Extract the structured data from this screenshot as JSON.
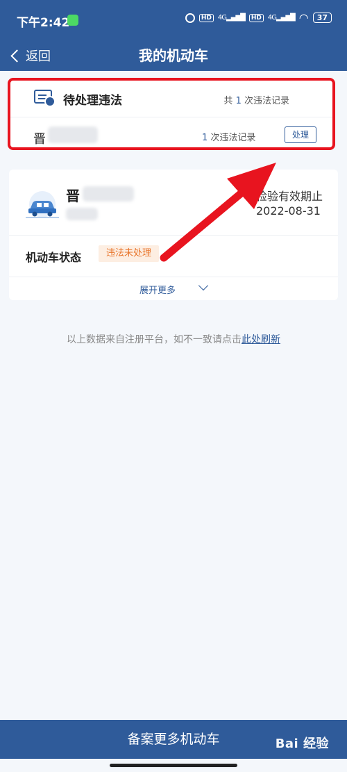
{
  "status_bar": {
    "time": "下午2:42",
    "network_label": "4G",
    "hd_label": "HD",
    "battery": "37"
  },
  "nav": {
    "back_label": "返回",
    "title": "我的机动车"
  },
  "violation": {
    "title": "待处理违法",
    "total_prefix": "共",
    "total_count": "1",
    "total_suffix": "次违法记录",
    "plate_province": "晋",
    "count": "1",
    "count_suffix": "次违法记录",
    "action_label": "处理"
  },
  "vehicle": {
    "plate_province": "晋",
    "inspection_label": "检验有效期止",
    "inspection_date": "2022-08-31",
    "status_label": "机动车状态",
    "status_value": "违法未处理",
    "expand_label": "展开更多"
  },
  "footnote": {
    "text": "以上数据来自注册平台，如不一致请点击",
    "link": "此处刷新"
  },
  "bottom_button": "备案更多机动车",
  "watermark": "Bai 经验",
  "colors": {
    "primary": "#2f5b9a",
    "highlight_border": "#e8141f",
    "badge_text": "#e8742a",
    "badge_bg": "#fdeee2"
  },
  "icons": [
    "violation-list-icon",
    "car-icon",
    "chevron-left-icon",
    "chevron-down-icon"
  ]
}
